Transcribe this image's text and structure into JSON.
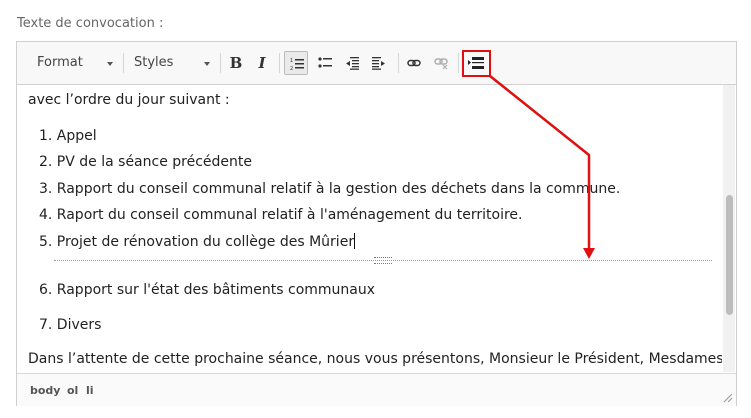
{
  "field_label": "Texte de convocation :",
  "toolbar": {
    "format_label": "Format",
    "styles_label": "Styles",
    "bold_label": "B",
    "italic_label": "I",
    "icons": [
      "numbered-list-icon",
      "bulleted-list-icon",
      "outdent-icon",
      "indent-icon",
      "link-icon",
      "unlink-icon",
      "page-break-icon"
    ]
  },
  "content": {
    "intro": "avec l’ordre du jour suivant :",
    "list_first": [
      "1. Appel",
      "2. PV de la séance précédente",
      "3. Rapport du conseil communal relatif à la gestion des déchets dans la commune.",
      "4. Raport du conseil communal relatif à l'aménagement du territoire.",
      "5. Projet de rénovation du collège des Mûrier"
    ],
    "list_second": [
      "6. Rapport sur l'état des bâtiments communaux",
      "7. Divers"
    ],
    "closing": "Dans l’attente de cette prochaine séance, nous vous présentons, Monsieur le Président, Mesdames et"
  },
  "statusbar": {
    "path": [
      "body",
      "ol",
      "li"
    ]
  },
  "colors": {
    "highlight": "#e01010",
    "toolbar_bg": "#f8f8f8"
  }
}
